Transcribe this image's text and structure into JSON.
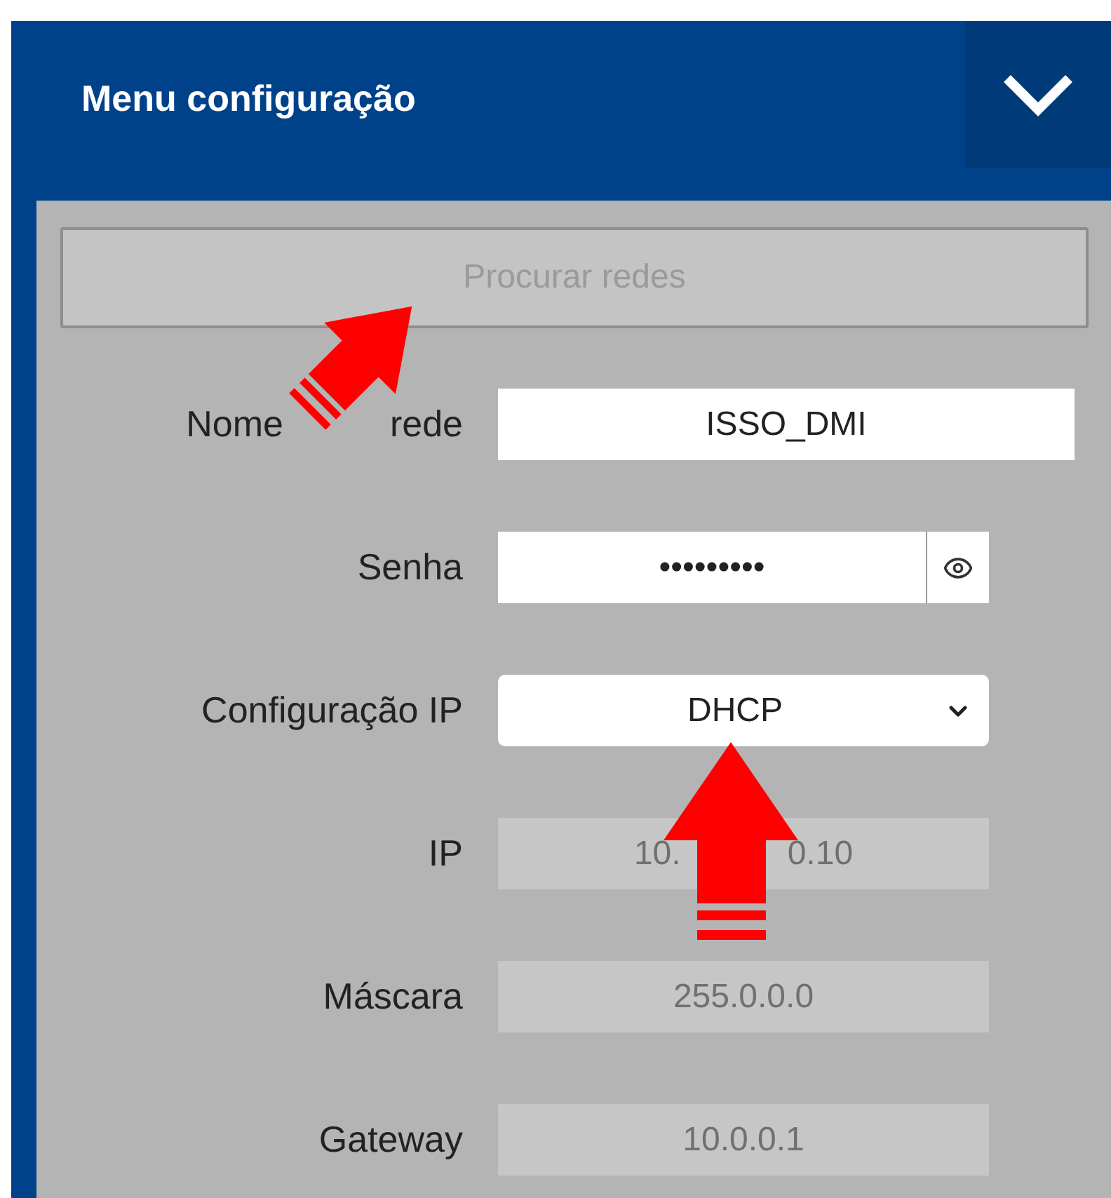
{
  "header": {
    "title": "Menu configuração",
    "expanded": true
  },
  "search_button": {
    "label": "Procurar redes",
    "disabled": true
  },
  "fields": [
    {
      "label": [
        "Nome",
        "rede"
      ],
      "value": "ISSO_DMI",
      "kind": "text"
    },
    {
      "label": "Senha",
      "value": "•••••••••",
      "kind": "password"
    },
    {
      "label": "Configuração IP",
      "value": "DHCP",
      "kind": "select"
    },
    {
      "label": "IP",
      "value": [
        "10.",
        "0.10"
      ],
      "kind": "readonly"
    },
    {
      "label": "Máscara",
      "value": "255.0.0.0",
      "kind": "readonly"
    },
    {
      "label": "Gateway",
      "value": "10.0.0.1",
      "kind": "readonly"
    }
  ],
  "annotations": [
    {
      "kind": "diagonal"
    },
    {
      "kind": "vertical"
    }
  ]
}
